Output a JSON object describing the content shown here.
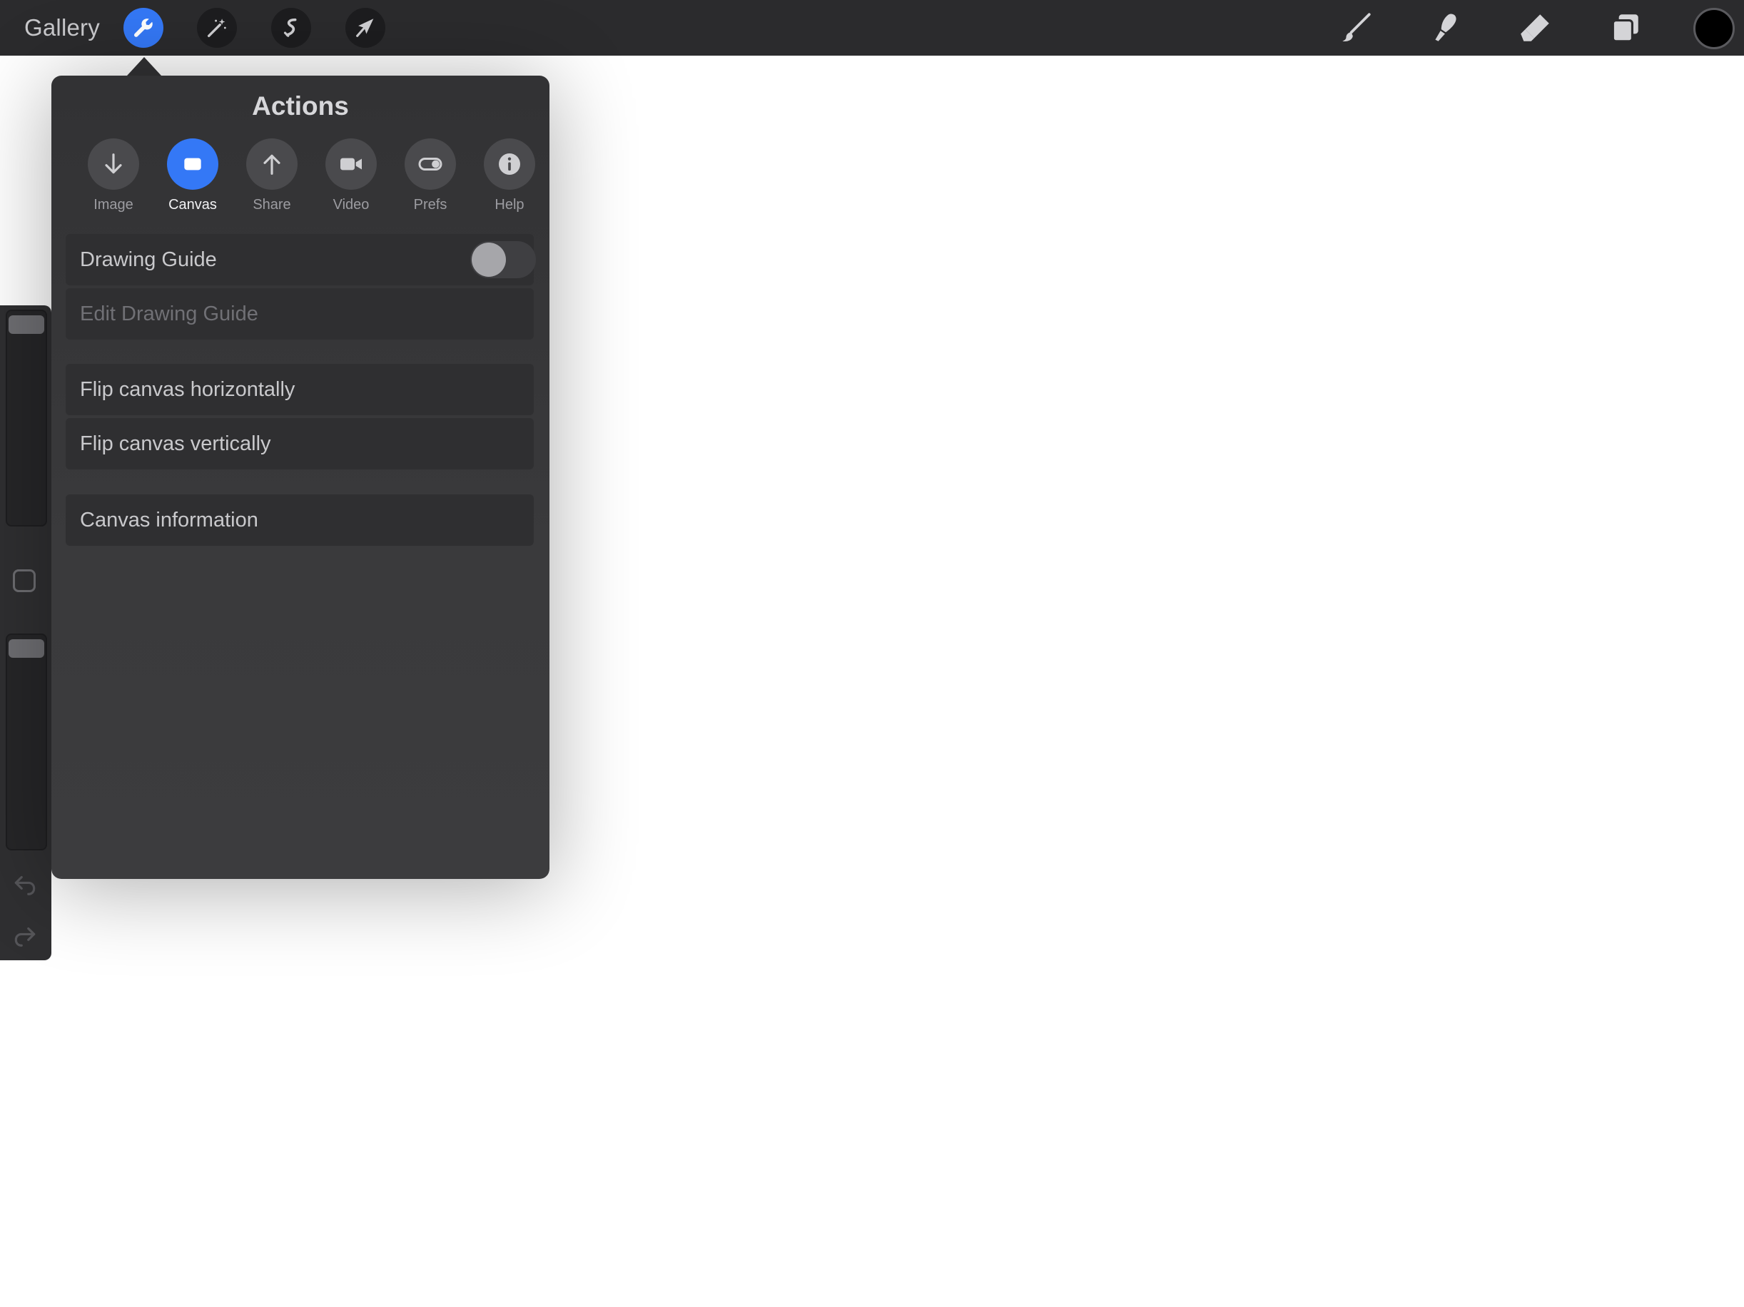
{
  "topbar": {
    "gallery_label": "Gallery",
    "left_tools": [
      "wrench-icon",
      "magic-wand-icon",
      "selection-icon",
      "transform-arrow-icon"
    ],
    "active_tool": "wrench-icon",
    "right_tools": [
      "brush-icon",
      "smudge-icon",
      "eraser-icon",
      "layers-icon"
    ],
    "current_color": "#000000"
  },
  "actions_panel": {
    "title": "Actions",
    "tabs": [
      {
        "label": "Image",
        "icon": "arrow-down-icon"
      },
      {
        "label": "Canvas",
        "icon": "canvas-icon",
        "active": true
      },
      {
        "label": "Share",
        "icon": "arrow-up-icon"
      },
      {
        "label": "Video",
        "icon": "video-camera-icon"
      },
      {
        "label": "Prefs",
        "icon": "toggle-icon"
      },
      {
        "label": "Help",
        "icon": "info-icon"
      }
    ],
    "rows": {
      "drawing_guide": "Drawing Guide",
      "drawing_guide_enabled": false,
      "edit_drawing_guide": "Edit Drawing Guide",
      "flip_horizontal": "Flip canvas horizontally",
      "flip_vertical": "Flip canvas vertically",
      "canvas_information": "Canvas information"
    }
  },
  "colors": {
    "accent": "#3478f6",
    "toolbar_bg": "#2b2b2d",
    "panel_bg": "#3a3a3c",
    "canvas_bg": "#ffffff"
  }
}
